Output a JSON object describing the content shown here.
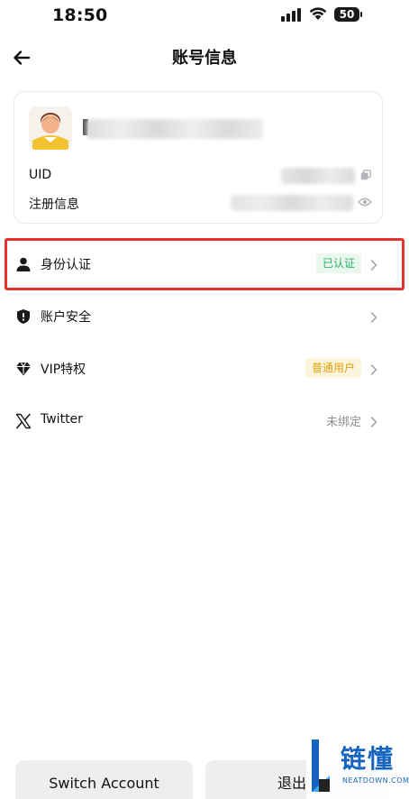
{
  "status_bar": {
    "time": "18:50",
    "battery": "50"
  },
  "header": {
    "title": "账号信息"
  },
  "account": {
    "uid_label": "UID",
    "registration_label": "注册信息"
  },
  "menu": [
    {
      "label": "身份认证",
      "badge": "已认证",
      "icon": "person-icon"
    },
    {
      "label": "账户安全",
      "icon": "shield-icon"
    },
    {
      "label": "VIP特权",
      "badge": "普通用户",
      "icon": "diamond-icon"
    },
    {
      "label": "Twitter",
      "status": "未绑定",
      "icon": "x-logo-icon"
    }
  ],
  "buttons": {
    "switch_account": "Switch Account",
    "logout": "退出"
  },
  "watermark": {
    "text": "链懂",
    "sub": "NEATDOWN.COM"
  },
  "colors": {
    "verified_badge_text": "#2db36b",
    "verified_badge_bg": "#e9f7ef",
    "vip_badge_text": "#e2a20b",
    "vip_badge_bg": "#fdf4dd",
    "highlight_border": "#e3342f",
    "watermark": "#1565c0"
  }
}
